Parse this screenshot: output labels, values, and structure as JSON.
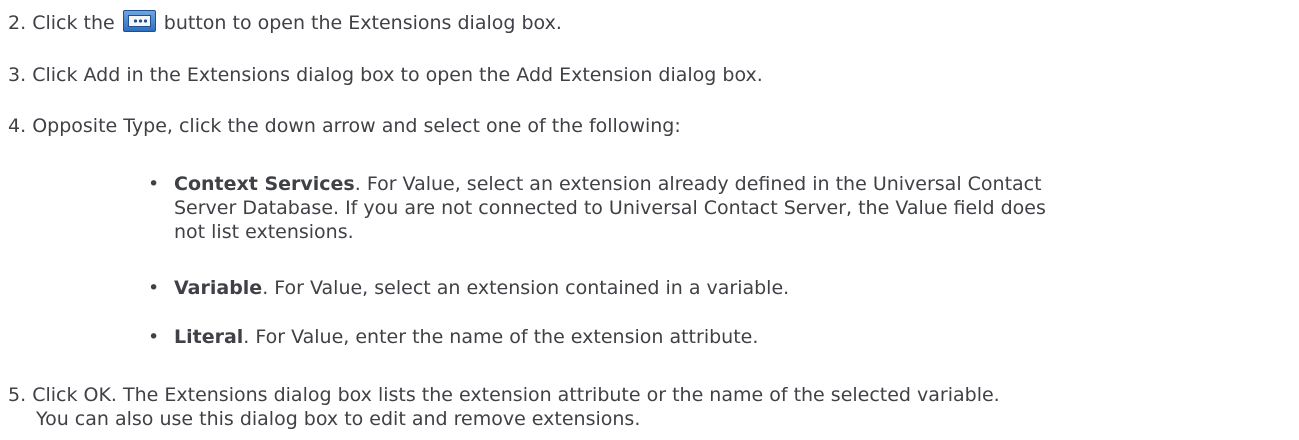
{
  "steps": {
    "s2": {
      "num": "2.",
      "before": "Click the",
      "after": "button to open the Extensions dialog box."
    },
    "s3": {
      "num": "3.",
      "text": "Click Add in the Extensions dialog box to open the Add Extension dialog box."
    },
    "s4": {
      "num": "4.",
      "text": "Opposite Type, click the down arrow and select one of the following:"
    },
    "s5": {
      "num": "5.",
      "line1": "Click OK. The Extensions dialog box lists the extension attribute or the name of the selected variable.",
      "line2": "You can also use this dialog box to edit and remove extensions."
    }
  },
  "bullets": {
    "b1": {
      "term": "Context Services",
      "line1": ". For Value, select an extension already defined in the Universal Contact",
      "line2": "Server Database. If you are not connected to Universal Contact Server, the Value field does",
      "line3": "not list extensions."
    },
    "b2": {
      "term": "Variable",
      "rest": ".  For Value, select an extension contained in a variable."
    },
    "b3": {
      "term": "Literal",
      "rest": ". For Value, enter the name of the extension attribute."
    }
  },
  "icons": {
    "extensions_button": "extensions-dialog-button-icon"
  },
  "colors": {
    "text": "#3f4146",
    "button_blue": "#2f6fbd"
  }
}
